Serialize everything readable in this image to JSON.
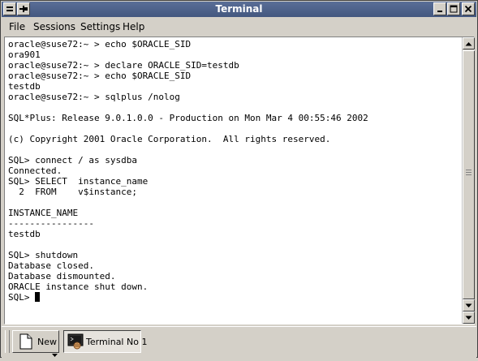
{
  "window": {
    "title": "Terminal"
  },
  "menu": {
    "items": [
      "File",
      "Sessions",
      "Settings",
      "Help"
    ]
  },
  "terminal": {
    "lines": [
      "oracle@suse72:~ > echo $ORACLE_SID",
      "ora901",
      "oracle@suse72:~ > declare ORACLE_SID=testdb",
      "oracle@suse72:~ > echo $ORACLE_SID",
      "testdb",
      "oracle@suse72:~ > sqlplus /nolog",
      "",
      "SQL*Plus: Release 9.0.1.0.0 - Production on Mon Mar 4 00:55:46 2002",
      "",
      "(c) Copyright 2001 Oracle Corporation.  All rights reserved.",
      "",
      "SQL> connect / as sysdba",
      "Connected.",
      "SQL> SELECT  instance_name",
      "  2  FROM    v$instance;",
      "",
      "INSTANCE_NAME",
      "----------------",
      "testdb",
      "",
      "SQL> shutdown",
      "Database closed.",
      "Database dismounted.",
      "ORACLE instance shut down.",
      "SQL> "
    ]
  },
  "taskbar": {
    "new_label": "New",
    "terminal_tab_label": "Terminal No 1"
  },
  "icons": {
    "window_menu": "window-menu-icon",
    "pin": "pin-icon",
    "minimize": "minimize-icon",
    "maximize": "maximize-icon",
    "close": "close-icon",
    "scroll_up": "scroll-up-arrow-icon",
    "scroll_down": "scroll-down-arrow-icon",
    "new_document": "new-document-icon",
    "terminal": "terminal-icon"
  },
  "colors": {
    "titlebar": "#4c6189",
    "titlebar_text": "#ffffff",
    "terminal_bg": "#ffffff",
    "terminal_fg": "#000000",
    "chrome": "#d4d0c8"
  }
}
